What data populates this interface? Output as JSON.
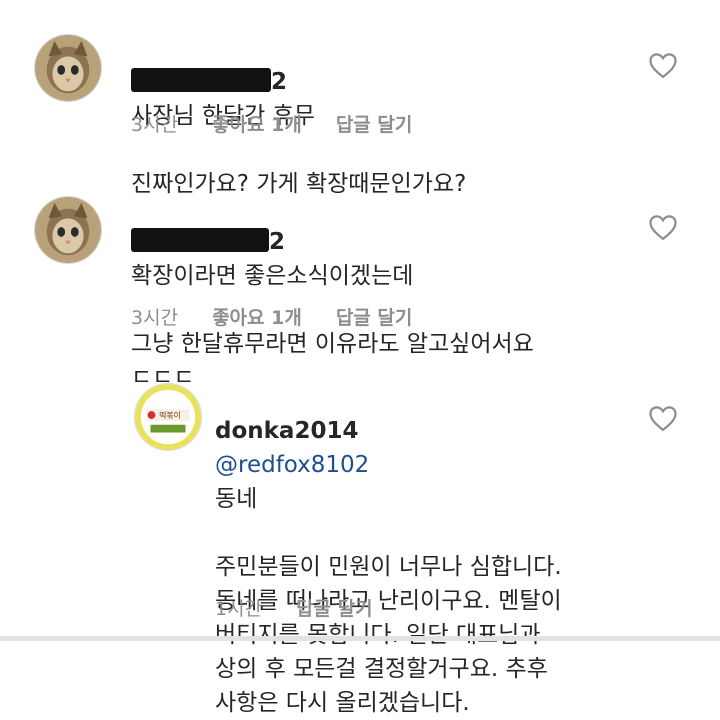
{
  "comments": [
    {
      "username_visible": "2",
      "text_line1": "사장님 한달간 휴무",
      "text_rest": "진짜인가요? 가게 확장때문인가요?",
      "time": "3시간",
      "likes": "좋아요 1개",
      "reply": "답글 달기"
    },
    {
      "username_visible": "2",
      "text_line1": "확장이라면 좋은소식이겠는데",
      "text_rest": "그냥 한달휴무라면 이유라도 알고싶어서요\nㄷㄷㄷ",
      "time": "3시간",
      "likes": "좋아요 1개",
      "reply": "답글 달기"
    },
    {
      "username": "donka2014",
      "mention": "@redfox8102",
      "text_line1": "동네",
      "text_rest": "주민분들이 민원이 너무나 심합니다.\n동네를 떠나라고 난리이구요. 멘탈이\n버티지를 못합니다. 일단 대표님과\n상의 후 모든걸 결정할거구요. 추후\n사항은 다시 올리겠습니다.",
      "time": "1시간",
      "reply": "답글 달기"
    }
  ],
  "icons": {
    "like": "heart-outline-icon",
    "avatar_cat": "cat-avatar-icon",
    "avatar_shop": "shop-logo-avatar-icon"
  },
  "colors": {
    "text": "#262626",
    "meta": "#8e8e8e",
    "mention": "#1d4f8f",
    "shop_logo_ring": "#d6d35a"
  }
}
